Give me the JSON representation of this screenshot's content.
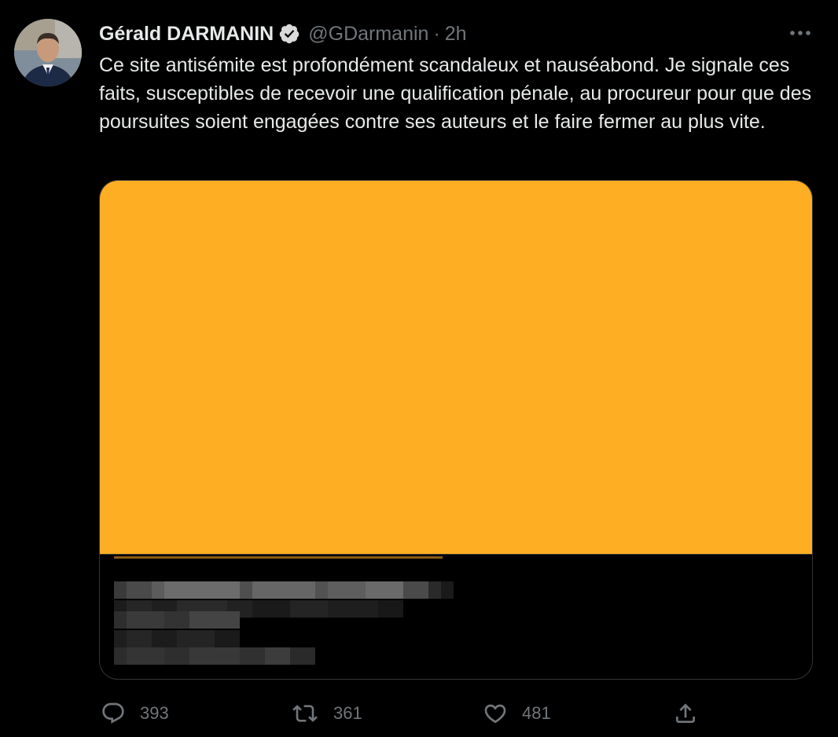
{
  "author": {
    "name": "Gérald DARMANIN",
    "handle": "@GDarmanin",
    "separator": "·",
    "time": "2h"
  },
  "tweet": {
    "text": "Ce site antisémite est profondément scandaleux et nauséabond. Je signale ces faits, susceptibles de recevoir une qualification pénale, au procureur pour que des poursuites soient engagées contre ses auteurs et le faire fermer au plus vite."
  },
  "card": {
    "image_color": "#fdae22",
    "content": "blurred"
  },
  "actions": {
    "replies": "393",
    "retweets": "361",
    "likes": "481"
  },
  "icons": {
    "reply": "reply-icon",
    "retweet": "retweet-icon",
    "like": "heart-icon",
    "share": "share-icon",
    "more": "more-icon",
    "verified": "verified-badge-icon"
  },
  "colors": {
    "background": "#000000",
    "text": "#e7e9ea",
    "muted": "#71767b",
    "card_border": "#333639"
  }
}
